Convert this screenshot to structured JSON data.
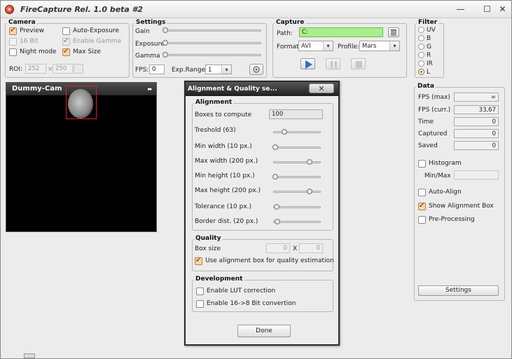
{
  "window": {
    "title": "FireCapture Rel. 1.0 beta #2",
    "minimize": "—",
    "maximize": "☐",
    "close": "✕"
  },
  "camera": {
    "title": "Camera",
    "preview": "Preview",
    "auto_exposure": "Auto-Exposure",
    "bit16": "16 Bit",
    "enable_gamma": "Enable Gamma",
    "night_mode": "Night mode",
    "max_size": "Max Size",
    "roi_label": "ROI:",
    "roi_w": "252",
    "roi_x": "×",
    "roi_h": "250"
  },
  "settings": {
    "title": "Settings",
    "gain": "Gain",
    "exposure": "Exposure",
    "gamma": "Gamma",
    "fps_label": "FPS:",
    "fps_value": "0",
    "exp_range_label": "Exp.Range:",
    "exp_range_value": "1"
  },
  "capture": {
    "title": "Capture",
    "path_label": "Path:",
    "path_value": "C:",
    "format_label": "Format:",
    "format_value": "AVI",
    "profile_label": "Profile:",
    "profile_value": "Mars"
  },
  "filter": {
    "title": "Filter",
    "options": [
      "UV",
      "B",
      "G",
      "R",
      "IR",
      "L"
    ],
    "selected": "L"
  },
  "cam_window": {
    "title": "Dummy-Cam",
    "minimize": "▬"
  },
  "dialog": {
    "title": "Alignment & Quality se...",
    "close": "✕",
    "alignment": {
      "title": "Alignment",
      "boxes_label": "Boxes to compute",
      "boxes_value": "100",
      "treshold": "Treshold (63)",
      "min_width": "Min width (10 px.)",
      "max_width": "Max width (200 px.)",
      "min_height": "Min height (10 px.)",
      "max_height": "Max height (200 px.)",
      "tolerance": "Tolerance (10 px.)",
      "border_dist": "Border dist. (20 px.)"
    },
    "quality": {
      "title": "Quality",
      "box_size_label": "Box size",
      "box_w": "0",
      "box_x": "X",
      "box_h": "0",
      "use_alignment_box": "Use alignment box for quality estimation"
    },
    "development": {
      "title": "Development",
      "lut": "Enable LUT correction",
      "bit_conv": "Enable 16->8 Bit convertion"
    },
    "done": "Done"
  },
  "data": {
    "title": "Data",
    "fps_max_label": "FPS (max)",
    "fps_max_value": "=",
    "fps_curr_label": "FPS (curr.)",
    "fps_curr_value": "33,67",
    "time_label": "Time",
    "time_value": "0",
    "captured_label": "Captured",
    "captured_value": "0",
    "saved_label": "Saved",
    "saved_value": "0",
    "histogram": "Histogram",
    "minmax_label": "Min/Max",
    "auto_align": "Auto-Align",
    "show_alignment_box": "Show Alignment Box",
    "pre_processing": "Pre-Processing",
    "settings_btn": "Settings"
  }
}
